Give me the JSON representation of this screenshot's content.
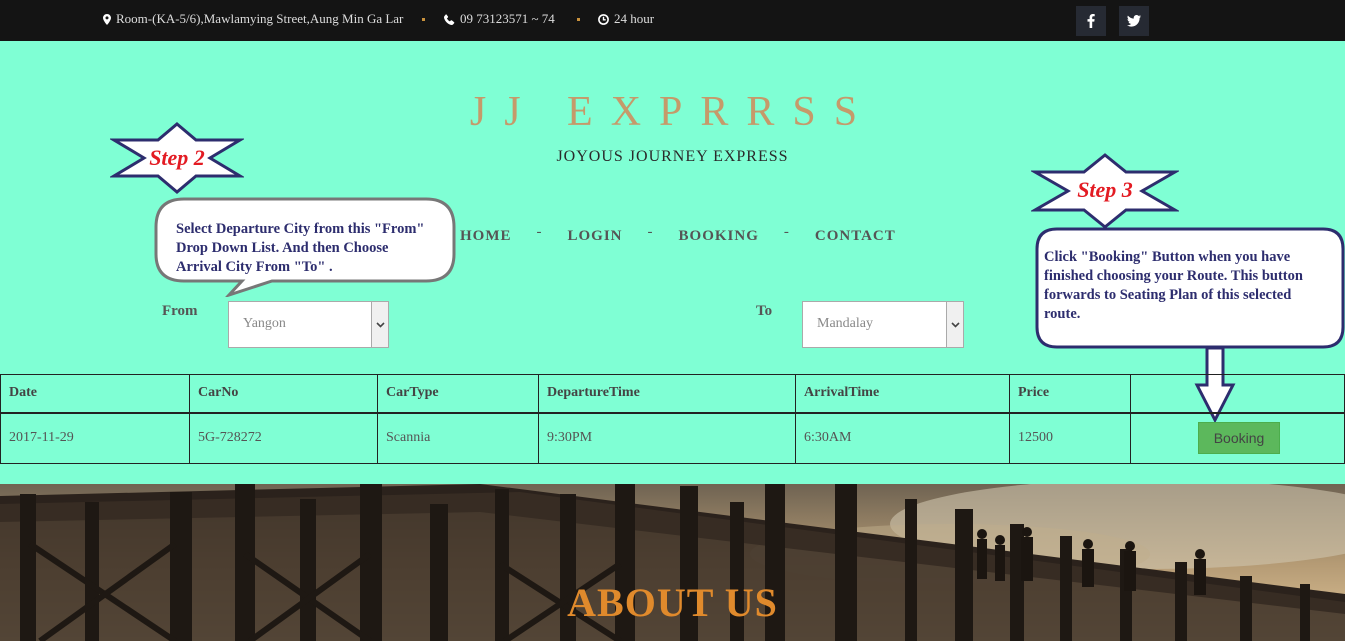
{
  "topbar": {
    "address": "Room-(KA-5/6),Mawlamying Street,Aung Min Ga Lar",
    "phone": "09 73123571 ~ 74",
    "hours": "24 hour",
    "social": [
      "facebook-icon",
      "twitter-icon"
    ]
  },
  "header": {
    "brand": "JJ EXPRRSS",
    "tagline": "JOYOUS JOURNEY EXPRESS"
  },
  "nav": {
    "home": "HOME",
    "login": "LOGIN",
    "booking": "BOOKING",
    "contact": "CONTACT",
    "separator": "-"
  },
  "steps": {
    "step2": "Step 2",
    "step3": "Step 3"
  },
  "callouts": {
    "step2_text": "Select Departure City from this \"From\" Drop Down List. And then Choose Arrival City From \"To\" .",
    "step3_text": "Click \"Booking\" Button when you have finished choosing your Route. This button forwards to Seating Plan of this selected route."
  },
  "form": {
    "from_label": "From",
    "from_value": "Yangon",
    "to_label": "To",
    "to_value": "Mandalay"
  },
  "table": {
    "headers": [
      "Date",
      "CarNo",
      "CarType",
      "DepartureTime",
      "ArrivalTime",
      "Price",
      ""
    ],
    "rows": [
      [
        "2017-11-29",
        "5G-728272",
        "Scannia",
        "9:30PM",
        "6:30AM",
        "12500"
      ]
    ],
    "book_label": "Booking"
  },
  "about": {
    "title": "ABOUT US"
  },
  "colors": {
    "background": "#7fffd4",
    "topbar": "#141414",
    "brand": "#c59a6a",
    "step_label": "#e31b23",
    "callout_text": "#2d2d6e",
    "booking_button": "#5cb85c",
    "about_title": "#e08a2c"
  }
}
